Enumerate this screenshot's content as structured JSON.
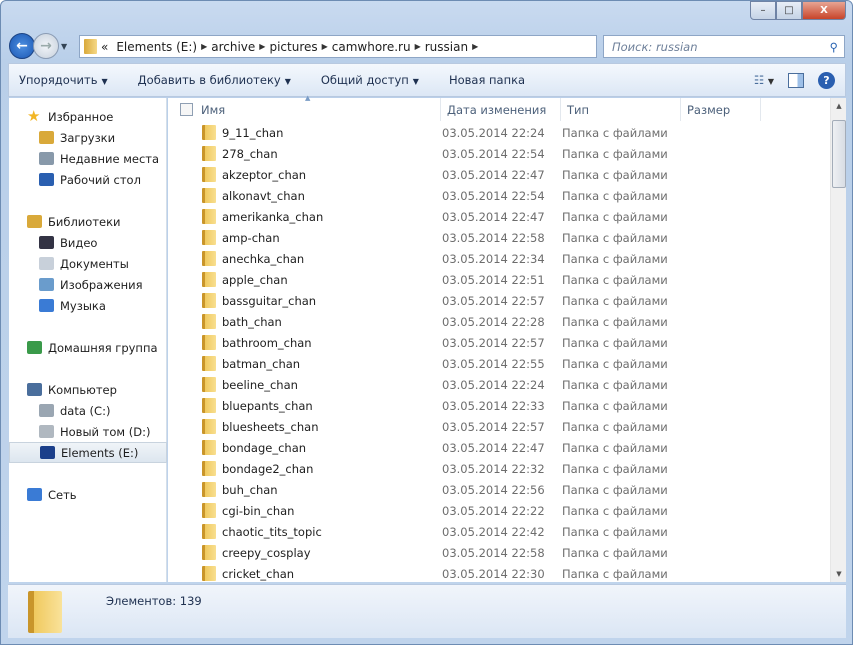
{
  "window": {
    "buttons": {
      "minimize": "–",
      "maximize": "□",
      "close": "X"
    }
  },
  "address": {
    "overflow": "«",
    "segments": [
      "Elements (E:)",
      "archive",
      "pictures",
      "camwhore.ru",
      "russian"
    ]
  },
  "search": {
    "placeholder": "Поиск: russian"
  },
  "toolbar": {
    "organize": "Упорядочить",
    "add_to_library": "Добавить в библиотеку",
    "share": "Общий доступ",
    "new_folder": "Новая папка"
  },
  "sidebar": {
    "items": [
      {
        "label": "Избранное",
        "top": true,
        "icon": "star-icon",
        "color": "#f2b626"
      },
      {
        "label": "Загрузки",
        "icon": "downloads-icon",
        "color": "#d9a93a"
      },
      {
        "label": "Недавние места",
        "icon": "recent-places-icon",
        "color": "#8899aa"
      },
      {
        "label": "Рабочий стол",
        "icon": "desktop-icon",
        "color": "#2a5fb0"
      },
      {
        "label": "Библиотеки",
        "top": true,
        "icon": "libraries-icon",
        "color": "#d9a93a"
      },
      {
        "label": "Видео",
        "icon": "video-icon",
        "color": "#334"
      },
      {
        "label": "Документы",
        "icon": "documents-icon",
        "color": "#c8d0da"
      },
      {
        "label": "Изображения",
        "icon": "pictures-icon",
        "color": "#6a9ccc"
      },
      {
        "label": "Музыка",
        "icon": "music-icon",
        "color": "#3a7bd5"
      },
      {
        "label": "Домашняя группа",
        "top": true,
        "icon": "homegroup-icon",
        "color": "#3a9a4a"
      },
      {
        "label": "Компьютер",
        "top": true,
        "icon": "computer-icon",
        "color": "#4a6e9c"
      },
      {
        "label": "data (C:)",
        "icon": "drive-c-icon",
        "color": "#9aa6b2"
      },
      {
        "label": "Новый том (D:)",
        "icon": "drive-d-icon",
        "color": "#b0b8c0"
      },
      {
        "label": "Elements (E:)",
        "icon": "drive-e-icon",
        "color": "#1b3f8a",
        "selected": true
      },
      {
        "label": "Сеть",
        "top": true,
        "icon": "network-icon",
        "color": "#3a7bd5"
      }
    ]
  },
  "columns": {
    "name": "Имя",
    "date": "Дата изменения",
    "type": "Тип",
    "size": "Размер"
  },
  "files": [
    {
      "name": "9_11_chan",
      "date": "03.05.2014 22:24",
      "type": "Папка с файлами"
    },
    {
      "name": "278_chan",
      "date": "03.05.2014 22:54",
      "type": "Папка с файлами"
    },
    {
      "name": "akzeptor_chan",
      "date": "03.05.2014 22:47",
      "type": "Папка с файлами"
    },
    {
      "name": "alkonavt_chan",
      "date": "03.05.2014 22:54",
      "type": "Папка с файлами"
    },
    {
      "name": "amerikanka_chan",
      "date": "03.05.2014 22:47",
      "type": "Папка с файлами"
    },
    {
      "name": "amp-chan",
      "date": "03.05.2014 22:58",
      "type": "Папка с файлами"
    },
    {
      "name": "anechka_chan",
      "date": "03.05.2014 22:34",
      "type": "Папка с файлами"
    },
    {
      "name": "apple_chan",
      "date": "03.05.2014 22:51",
      "type": "Папка с файлами"
    },
    {
      "name": "bassguitar_chan",
      "date": "03.05.2014 22:57",
      "type": "Папка с файлами"
    },
    {
      "name": "bath_chan",
      "date": "03.05.2014 22:28",
      "type": "Папка с файлами"
    },
    {
      "name": "bathroom_chan",
      "date": "03.05.2014 22:57",
      "type": "Папка с файлами"
    },
    {
      "name": "batman_chan",
      "date": "03.05.2014 22:55",
      "type": "Папка с файлами"
    },
    {
      "name": "beeline_chan",
      "date": "03.05.2014 22:24",
      "type": "Папка с файлами"
    },
    {
      "name": "bluepants_chan",
      "date": "03.05.2014 22:33",
      "type": "Папка с файлами"
    },
    {
      "name": "bluesheets_chan",
      "date": "03.05.2014 22:57",
      "type": "Папка с файлами"
    },
    {
      "name": "bondage_chan",
      "date": "03.05.2014 22:47",
      "type": "Папка с файлами"
    },
    {
      "name": "bondage2_chan",
      "date": "03.05.2014 22:32",
      "type": "Папка с файлами"
    },
    {
      "name": "buh_chan",
      "date": "03.05.2014 22:56",
      "type": "Папка с файлами"
    },
    {
      "name": "cgi-bin_chan",
      "date": "03.05.2014 22:22",
      "type": "Папка с файлами"
    },
    {
      "name": "chaotic_tits_topic",
      "date": "03.05.2014 22:42",
      "type": "Папка с файлами"
    },
    {
      "name": "creepy_cosplay",
      "date": "03.05.2014 22:58",
      "type": "Папка с файлами"
    },
    {
      "name": "cricket_chan",
      "date": "03.05.2014 22:30",
      "type": "Папка с файлами"
    }
  ],
  "status": {
    "count": "Элементов: 139"
  }
}
